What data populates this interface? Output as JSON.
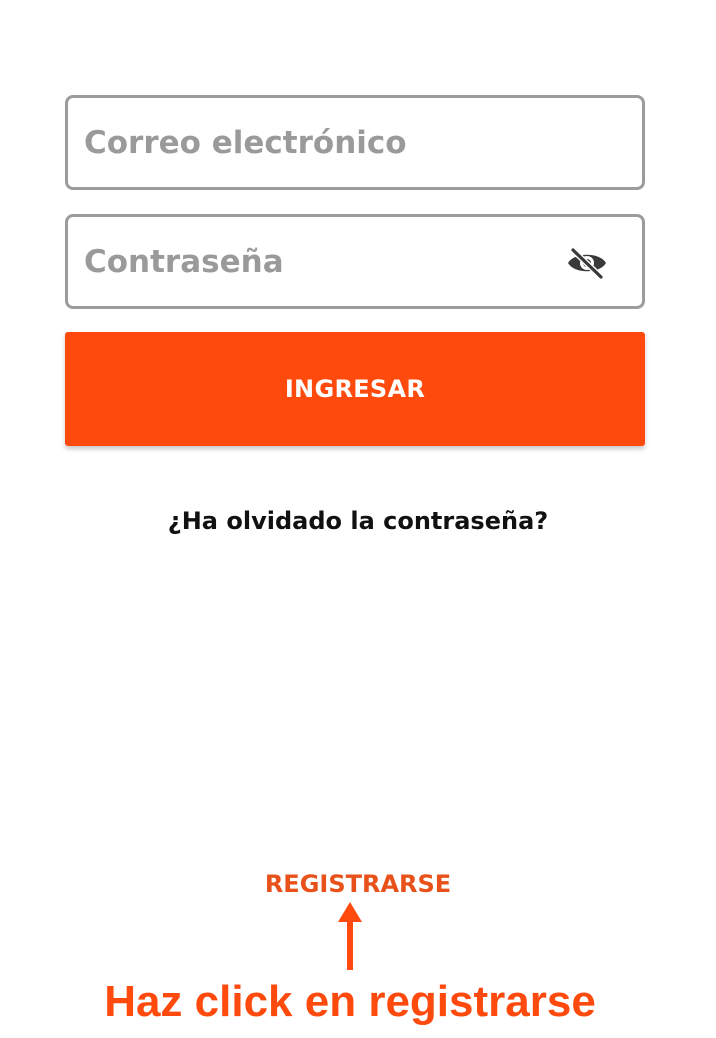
{
  "login_form": {
    "email_placeholder": "Correo electrónico",
    "email_value": "",
    "password_placeholder": "Contraseña",
    "password_value": "",
    "password_visibility_icon": "eye-off-icon",
    "submit_label": "INGRESAR",
    "forgot_password_label": "¿Ha olvidado la contraseña?"
  },
  "register": {
    "label": "REGISTRARSE"
  },
  "annotation": {
    "arrow_icon": "up-arrow-icon",
    "instruction": "Haz click en registrarse"
  },
  "colors": {
    "accent": "#ff4a0d",
    "register_text": "#e8511a",
    "field_border": "#9c9c9c",
    "placeholder": "#9a9a9a"
  }
}
